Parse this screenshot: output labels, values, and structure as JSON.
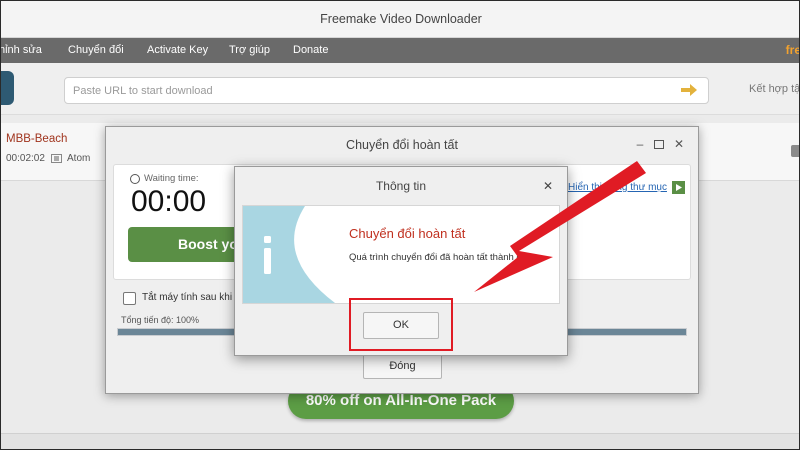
{
  "window": {
    "title": "Freemake Video Downloader"
  },
  "menu": {
    "items": [
      {
        "label": "hỉnh sửa"
      },
      {
        "label": "Chuyển đổi"
      },
      {
        "label": "Activate Key"
      },
      {
        "label": "Trợ giúp"
      },
      {
        "label": "Donate"
      }
    ],
    "brand_fragment": "fre"
  },
  "toolbar": {
    "url_placeholder": "Paste URL to start download",
    "merge_label": "Kết hợp tậ",
    "go_icon": "arrow-right-icon"
  },
  "download_item": {
    "title": "MBB-Beach",
    "duration": "00:02:02",
    "codec": "Atom"
  },
  "promo": {
    "label": "80% off on All-In-One Pack"
  },
  "conversion_dialog": {
    "title": "Chuyển đổi hoàn tất",
    "waiting_label": "Waiting time:",
    "waiting_time": "00:00",
    "boost_label": "Boost yo",
    "folder_link": "Hiển thị trong thư mục",
    "shutdown_label": "Tắt máy tính sau khi quá",
    "progress_label": "Tổng tiến độ: 100%",
    "progress_value": 1.0,
    "close_label": "Đóng"
  },
  "info_dialog": {
    "title": "Thông tin",
    "heading": "Chuyển đổi hoàn tất",
    "message": "Quá trình chuyển đổi đã hoàn tất thành công.",
    "ok_label": "OK",
    "icon": "info-icon"
  },
  "colors": {
    "menu_bg": "#6a6a6a",
    "accent_orange": "#f2a22e",
    "heading_red": "#c0301f",
    "button_green": "#5a8f45",
    "annotation_red": "#e01b24"
  }
}
